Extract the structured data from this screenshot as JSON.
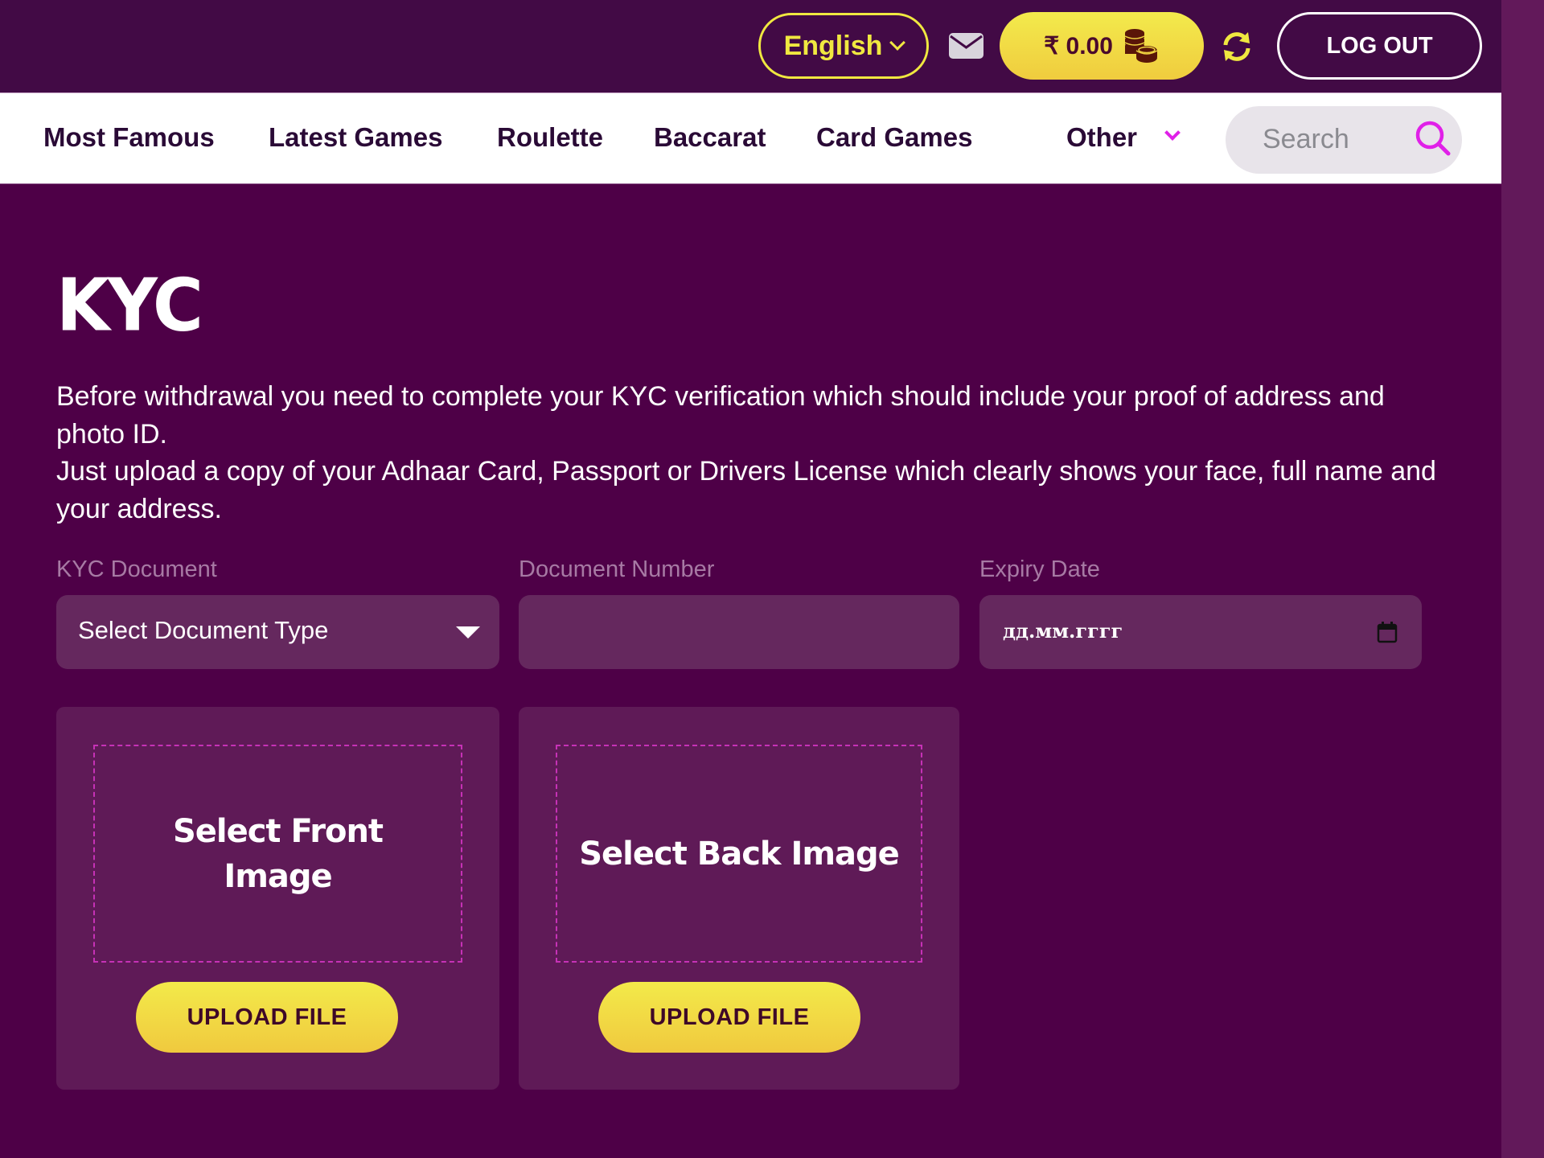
{
  "header": {
    "language": "English",
    "balance": "₹ 0.00",
    "logout_label": "LOG OUT",
    "icons": {
      "mail": "mail-icon",
      "coins": "coins-icon",
      "refresh": "refresh-icon",
      "language_chevron": "chevron-down-icon"
    }
  },
  "nav": {
    "items": [
      {
        "label": "Most Famous"
      },
      {
        "label": "Latest Games"
      },
      {
        "label": "Roulette"
      },
      {
        "label": "Baccarat"
      },
      {
        "label": "Card Games"
      },
      {
        "label": "Other"
      }
    ],
    "search_placeholder": "Search"
  },
  "page": {
    "title": "KYC",
    "intro_line1": "Before withdrawal you need to complete your KYC verification which should include your proof of address and photo ID.",
    "intro_line2": "Just upload a copy of your Adhaar Card, Passport or Drivers License which clearly shows your face, full name and your address."
  },
  "form": {
    "document_label": "KYC Document",
    "document_value": "Select Document Type",
    "number_label": "Document Number",
    "number_value": "",
    "expiry_label": "Expiry Date",
    "expiry_placeholder": "дд.мм.гггг"
  },
  "uploads": {
    "front_label": "Select Front Image",
    "back_label": "Select Back Image",
    "button_label": "UPLOAD FILE"
  },
  "colors": {
    "header_bg": "#420a45",
    "page_bg": "#4e0047",
    "accent_yellow": "#f0e840",
    "accent_magenta": "#e020e8",
    "field_bg": "#65285e",
    "card_bg": "#5f1a57"
  }
}
